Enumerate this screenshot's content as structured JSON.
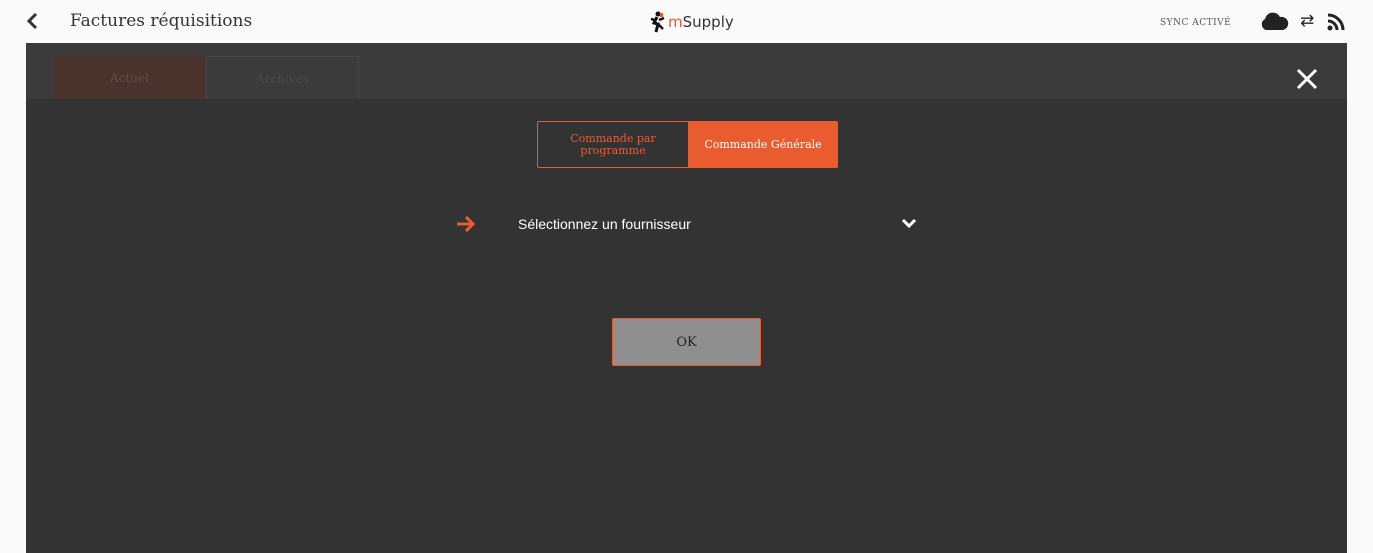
{
  "header": {
    "title": "Factures réquisitions",
    "logo_prefix": "m",
    "logo_suffix": "Supply",
    "sync_label": "SYNC ACTIVÉ"
  },
  "background_tabs": [
    "Actuel",
    "Archives"
  ],
  "modal": {
    "segments": {
      "left": "Commande par programme",
      "right": "Commande Générale",
      "selected": "Commande Générale"
    },
    "supplier_select": {
      "label": "Sélectionnez un fournisseur"
    },
    "ok_label": "OK"
  },
  "colors": {
    "accent": "#e95c30",
    "overlay": "#333333",
    "ok_button": "#8f8f8f"
  },
  "icons": [
    "chevron-left-icon",
    "msupply-logo-icon",
    "cloud-icon",
    "sync-arrows-icon",
    "rss-icon",
    "close-icon",
    "arrow-right-icon",
    "chevron-down-icon"
  ]
}
